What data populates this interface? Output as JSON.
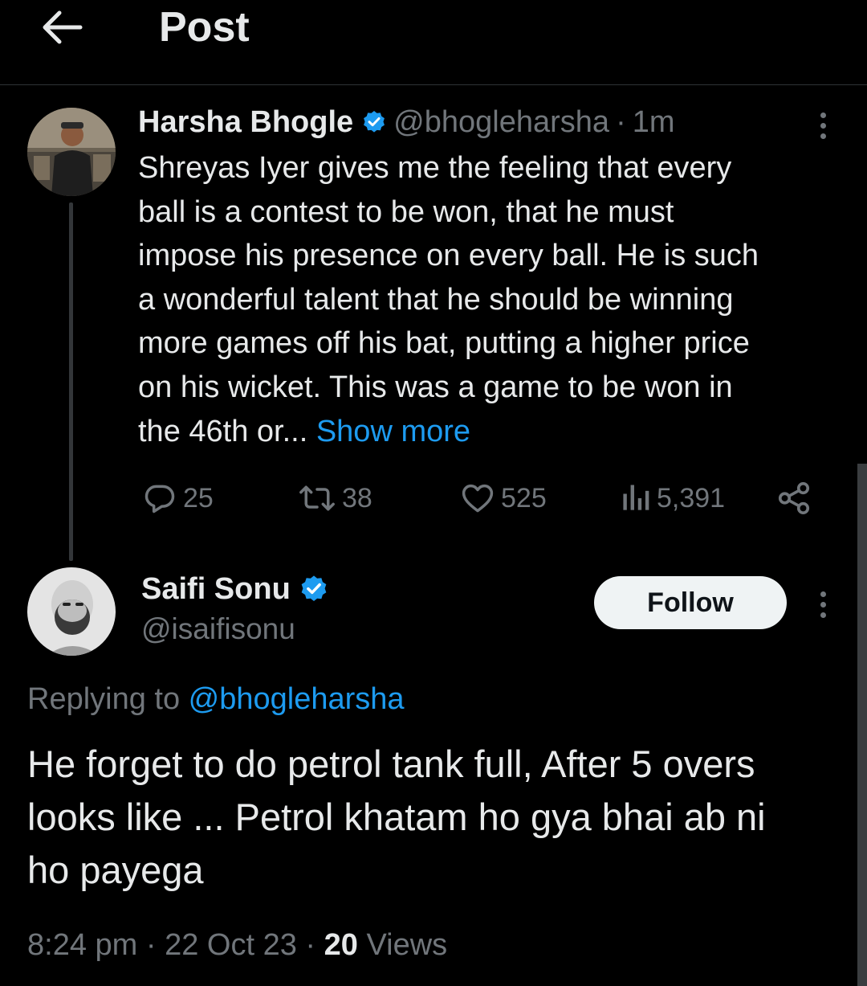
{
  "header": {
    "title": "Post"
  },
  "original_post": {
    "author_name": "Harsha Bhogle",
    "handle": "@bhogleharsha",
    "separator": "·",
    "time": "1m",
    "lines": [
      "Shreyas Iyer gives me the feeling that every",
      "ball is a contest to be won, that he must",
      "impose his presence on every ball. He is such",
      "a wonderful talent that he should be winning",
      "more games off his bat, putting a higher price",
      "on his wicket. This was a game to be won in",
      "the 46th or... "
    ],
    "show_more": "Show more",
    "stats": {
      "replies": "25",
      "reposts": "38",
      "likes": "525",
      "views": "5,391"
    }
  },
  "reply": {
    "author_name": "Saifi Sonu",
    "handle": "@isaifisonu",
    "follow_label": "Follow",
    "replying_prefix": "Replying to ",
    "replying_to": "@bhogleharsha",
    "lines": [
      "He forget to do petrol tank full, After 5 overs",
      "looks like ... Petrol khatam ho gya bhai ab ni",
      "ho payega"
    ],
    "time": "8:24 pm",
    "sep1": " · ",
    "date": "22 Oct 23",
    "sep2": " · ",
    "views_count": "20",
    "views_label": " Views"
  },
  "colors": {
    "background": "#000000",
    "text": "#e7e9ea",
    "muted": "#71767b",
    "accent": "#1d9bf0",
    "verified": "#1d9bf0",
    "follow_bg": "#eff3f4"
  },
  "icons": [
    "back-arrow-icon",
    "verified-badge-icon",
    "more-options-icon",
    "reply-icon",
    "repost-icon",
    "like-icon",
    "views-icon",
    "share-icon"
  ]
}
